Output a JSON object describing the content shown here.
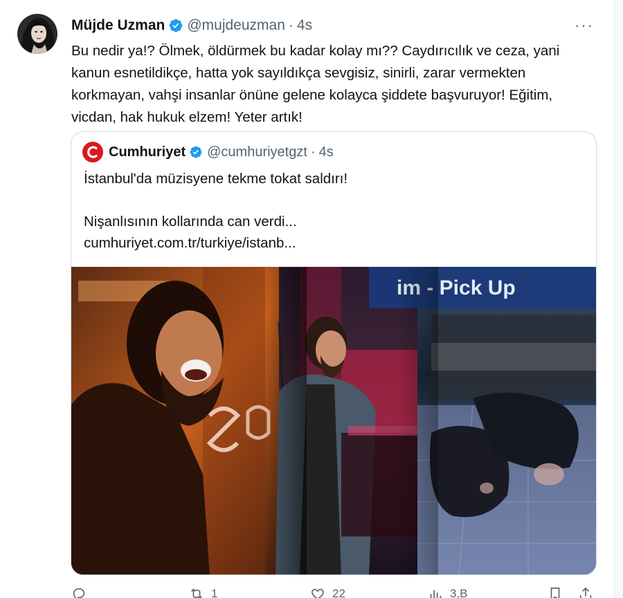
{
  "tweet": {
    "display_name": "Müjde Uzman",
    "handle": "@mujdeuzman",
    "separator": "·",
    "time": "4s",
    "more_label": "···",
    "text": "Bu nedir ya!? Ölmek, öldürmek bu kadar kolay mı?? Caydırıcılık ve ceza, yani kanun esnetildikçe, hatta yok sayıldıkça sevgisiz, sinirli, zarar vermekten korkmayan, vahşi insanlar önüne gelene kolayca şiddete başvuruyor! Eğitim, vicdan, hak hukuk elzem! Yeter artık!"
  },
  "quote": {
    "display_name": "Cumhuriyet",
    "handle": "@cumhuriyetgzt",
    "separator": "·",
    "time": "4s",
    "line1": "İstanbul'da müzisyene tekme tokat saldırı!",
    "line2": "",
    "line3": "Nişanlısının kollarında can verdi...",
    "line4": "cumhuriyet.com.tr/turkiye/istanb...",
    "media_overlay_text": "im - Pick Up"
  },
  "actions": {
    "reply_count": "",
    "retweet_count": "1",
    "like_count": "22",
    "views_count": "3,B"
  },
  "colors": {
    "text": "#0f1419",
    "secondary": "#536471",
    "verified": "#1d9bf0",
    "border": "#cfd9de",
    "cumhuriyet_red": "#d71920"
  },
  "icons": [
    "verified-badge-icon",
    "more-icon",
    "cumhuriyet-logo-icon",
    "reply-icon",
    "retweet-icon",
    "like-icon",
    "views-icon",
    "bookmark-icon",
    "share-icon"
  ]
}
